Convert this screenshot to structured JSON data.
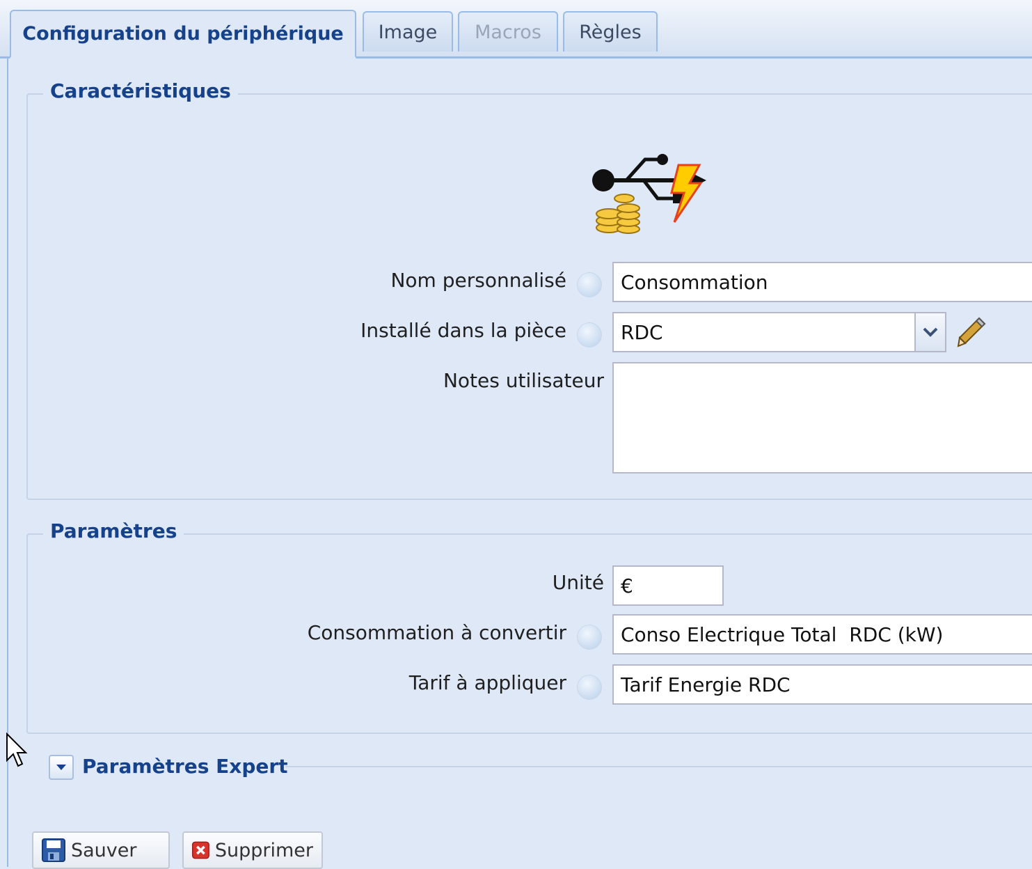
{
  "tabs": [
    {
      "label": "Configuration du périphérique"
    },
    {
      "label": "Image"
    },
    {
      "label": "Macros"
    },
    {
      "label": "Règles"
    }
  ],
  "caracteristiques": {
    "legend": "Caractéristiques",
    "icon": "usb-coins-energy-icon",
    "nom_label": "Nom personnalisé",
    "nom_value": "Consommation",
    "piece_label": "Installé dans la pièce",
    "piece_value": "RDC",
    "notes_label": "Notes utilisateur",
    "notes_value": ""
  },
  "parametres": {
    "legend": "Paramètres",
    "unite_label": "Unité",
    "unite_value": "€",
    "conso_label": "Consommation à convertir",
    "conso_value": "Conso Electrique Total  RDC (kW)",
    "tarif_label": "Tarif à appliquer",
    "tarif_value": "Tarif Energie RDC"
  },
  "expert": {
    "legend": "Paramètres Expert"
  },
  "buttons": {
    "save": "Sauver",
    "delete": "Supprimer"
  },
  "colors": {
    "accent": "#15428b",
    "panel": "#dfe8f6",
    "border": "#99bbe8"
  }
}
